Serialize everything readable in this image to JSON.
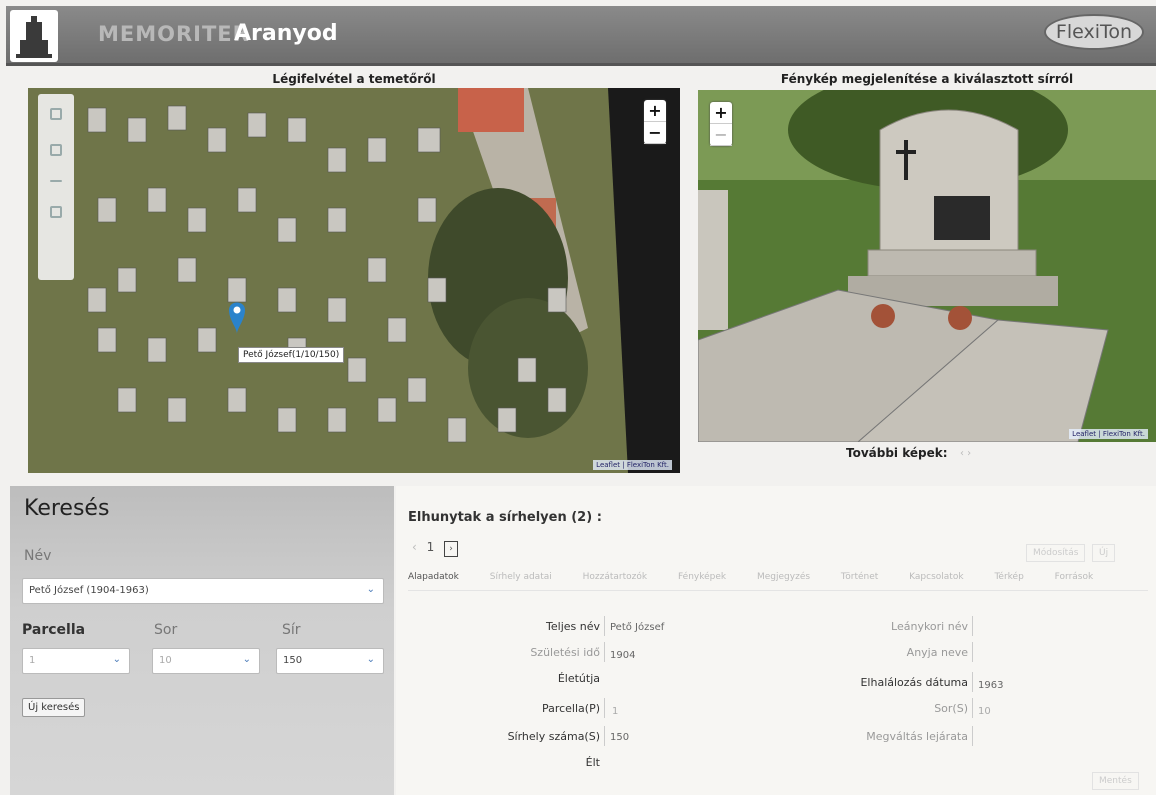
{
  "header": {
    "brand": "MEMORITER",
    "site": "Aranyod",
    "logo_text": "FlexiTon"
  },
  "map_panel": {
    "title": "Légifelvétel a temetőről",
    "zoom_in": "+",
    "zoom_out": "−",
    "marker_label": "Pető József(1/10/150)",
    "attribution": "Leaflet | FlexiTon Kft."
  },
  "photo_panel": {
    "title": "Fénykép megjelenítése a kiválasztott sírról",
    "zoom_in": "+",
    "zoom_out": "−",
    "attribution": "Leaflet | FlexiTon Kft.",
    "further_images": "További képek:"
  },
  "search": {
    "title": "Keresés",
    "name_label": "Név",
    "name_value": "Pető József (1904-1963)",
    "parcel_label": "Parcella",
    "parcel_value": "1",
    "row_label": "Sor",
    "row_value": "10",
    "grave_label": "Sír",
    "grave_value": "150",
    "new_search": "Új keresés"
  },
  "details": {
    "title": "Elhunytak a sírhelyen (2) :",
    "page": "1",
    "prev": "‹",
    "next": "›",
    "tabs": [
      "Alapadatok",
      "Sírhely adatai",
      "Hozzátartozók",
      "Fényképek",
      "Megjegyzés",
      "Történet",
      "Kapcsolatok",
      "Térkép",
      "Források"
    ],
    "btn_modify": "Módosítás",
    "btn_new": "Új",
    "btn_save": "Mentés",
    "fields": {
      "full_name_label": "Teljes név",
      "full_name": "Pető József",
      "birth_label": "Születési idő",
      "birth": "1904",
      "life_label": "Életútja",
      "parcel_label": "Parcella(P)",
      "parcel": "1",
      "grave_no_label": "Sírhely száma(S)",
      "grave_no": "150",
      "age_label": "Élt",
      "maiden_label": "Leánykori név",
      "mother_label": "Anyja neve",
      "death_label": "Elhalálozás dátuma",
      "death": "1963",
      "row_label": "Sor(S)",
      "row": "10",
      "expiry_label": "Megváltás lejárata"
    }
  }
}
